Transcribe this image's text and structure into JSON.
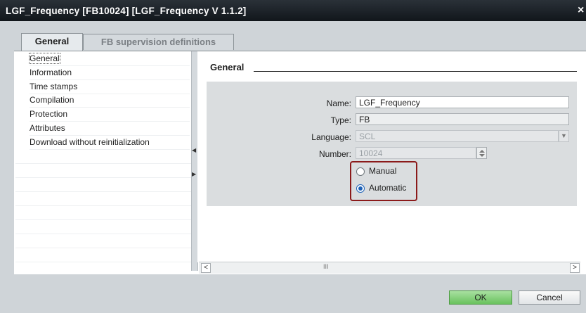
{
  "window": {
    "title": "LGF_Frequency [FB10024] [LGF_Frequency V 1.1.2]",
    "close_glyph": "×"
  },
  "tabs": [
    {
      "label": "General",
      "active": true
    },
    {
      "label": "FB supervision definitions",
      "active": false
    }
  ],
  "nav": {
    "items": [
      {
        "label": "General",
        "selected": true
      },
      {
        "label": "Information"
      },
      {
        "label": "Time stamps"
      },
      {
        "label": "Compilation"
      },
      {
        "label": "Protection"
      },
      {
        "label": "Attributes"
      },
      {
        "label": "Download without reinitialization"
      }
    ]
  },
  "section": {
    "title": "General"
  },
  "form": {
    "name_label": "Name:",
    "name_value": "LGF_Frequency",
    "type_label": "Type:",
    "type_value": "FB",
    "language_label": "Language:",
    "language_value": "SCL",
    "number_label": "Number:",
    "number_value": "10024",
    "number_mode": {
      "options": [
        {
          "label": "Manual",
          "selected": false
        },
        {
          "label": "Automatic",
          "selected": true
        }
      ]
    }
  },
  "scrollbar": {
    "left_glyph": "<",
    "right_glyph": ">",
    "grip_glyph": "III"
  },
  "buttons": {
    "ok_label": "OK",
    "cancel_label": "Cancel"
  },
  "colors": {
    "ok_button": "#69c25e",
    "highlight_border": "#8b1a1a",
    "radio_selected": "#1f62b7"
  }
}
